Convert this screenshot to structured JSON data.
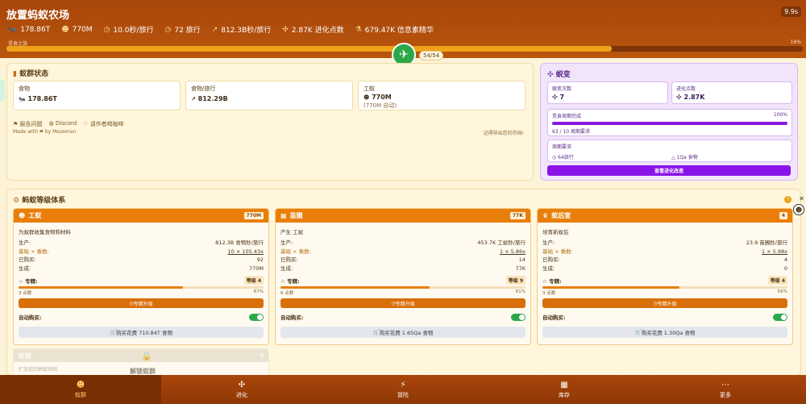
{
  "app": {
    "title": "放置蚂蚁农场",
    "speed": "9.9s"
  },
  "stats": [
    {
      "icon": "ant-icon",
      "glyph": "🐜",
      "value": "178.86T"
    },
    {
      "icon": "worker-icon",
      "glyph": "☻",
      "value": "770M"
    },
    {
      "icon": "clock-icon",
      "glyph": "◷",
      "value": "10.0秒/旅行"
    },
    {
      "icon": "clock-icon",
      "glyph": "◷",
      "value": "72 旅行"
    },
    {
      "icon": "trend-icon",
      "glyph": "↗",
      "value": "812.3B秒/旅行"
    },
    {
      "icon": "sparkle-icon",
      "glyph": "✣",
      "value": "2.87K 进化点数"
    },
    {
      "icon": "flask-icon",
      "glyph": "⚗",
      "value": "679.47K 信息素精华"
    }
  ],
  "evolution_bar": {
    "label": "觅食之旅",
    "percent_label": "16%",
    "progress": 0.76,
    "runner_count": "54/54"
  },
  "colony": {
    "title": "蚁群状态",
    "cards": [
      {
        "label": "食物",
        "icon": "ant-icon",
        "glyph": "🐜",
        "value": "178.86T",
        "sub": ""
      },
      {
        "label": "食物/旅行",
        "icon": "trend-icon",
        "glyph": "↗",
        "value": "812.29B",
        "sub": ""
      },
      {
        "label": "工蚁",
        "icon": "worker-icon",
        "glyph": "☻",
        "value": "770M",
        "sub": "(770M 自动)"
      }
    ],
    "links": [
      "报告问题",
      "Discord",
      "请作者喝咖啡"
    ],
    "made_with": "Made with ❤ by Mezeman",
    "export_tip": "记得导出您的存档!"
  },
  "mutation": {
    "title": "蜕变",
    "count_label": "蜕变次数",
    "count_value": "7",
    "points_label": "进化点数",
    "points_value": "2.87K",
    "cycle_label": "觅食周期完成",
    "cycle_pct": "100%",
    "cycle_progress": 1.0,
    "cycle_sub": "63 / 10 周期要求",
    "req_label": "周期要求",
    "req_trips": "64旅行",
    "req_food": "1Qa 食物",
    "button": "查看进化改造"
  },
  "tiers": {
    "title": "蚂蚁等级体系",
    "units": [
      {
        "name": "工蚁",
        "icon": "worker-icon",
        "glyph": "☻",
        "count": "770M",
        "desc": "为蚁群收集食物和材料",
        "produce_label": "生产:",
        "produce": "812.3B 食物秒/旅行",
        "base_label": "基础 × 乘数:",
        "base": "10 × 105.43x",
        "bought_label": "已购买:",
        "bought": "92",
        "made_label": "生成:",
        "made": "770M",
        "spec_label": "专精:",
        "spec_level": "等级 4",
        "spec_points": "3 点数",
        "spec_pct": "67%",
        "spec_progress": 0.67,
        "spec_button": "专精升级",
        "auto_label": "自动购买:",
        "buy_button": "购买花费 710.84T 食物"
      },
      {
        "name": "苗圃",
        "icon": "nursery-icon",
        "glyph": "▦",
        "count": "77K",
        "desc": "产生 工蚁",
        "produce_label": "生产:",
        "produce": "453.7K 工蚁秒/旅行",
        "base_label": "基础 × 乘数:",
        "base": "1 × 5.86x",
        "bought_label": "已购买:",
        "bought": "14",
        "made_label": "生成:",
        "made": "77K",
        "spec_label": "专精:",
        "spec_level": "等级 9",
        "spec_points": "6 点数",
        "spec_pct": "61%",
        "spec_progress": 0.61,
        "spec_button": "专精升级",
        "auto_label": "自动购买:",
        "buy_button": "购买花费 1.65Qa 食物"
      },
      {
        "name": "蚁后室",
        "icon": "queen-icon",
        "glyph": "♛",
        "count": "4",
        "desc": "培育新蚁后",
        "produce_label": "生产:",
        "produce": "23.9 苗圃秒/旅行",
        "base_label": "基础 × 乘数:",
        "base": "1 × 5.98x",
        "bought_label": "已购买:",
        "bought": "4",
        "made_label": "生成:",
        "made": "0",
        "spec_label": "专精:",
        "spec_level": "等级 4",
        "spec_points": "3 点数",
        "spec_pct": "56%",
        "spec_progress": 0.56,
        "spec_button": "专精升级",
        "auto_label": "自动购买:",
        "buy_button": "购买花费 1.30Qa 食物"
      }
    ],
    "locked": {
      "name": "蚁群",
      "count": "0",
      "desc": "扩张您的蚂蚁帝国",
      "unlock": "解锁蚁群"
    }
  },
  "nav": [
    {
      "label": "蚁群",
      "icon": "ant-icon",
      "glyph": "☻",
      "active": true
    },
    {
      "label": "进化",
      "icon": "sparkle-icon",
      "glyph": "✣",
      "active": false
    },
    {
      "label": "冒险",
      "icon": "bolt-icon",
      "glyph": "⚡",
      "active": false
    },
    {
      "label": "库存",
      "icon": "grid-icon",
      "glyph": "▦",
      "active": false
    },
    {
      "label": "更多",
      "icon": "more-icon",
      "glyph": "⋯",
      "active": false
    }
  ]
}
